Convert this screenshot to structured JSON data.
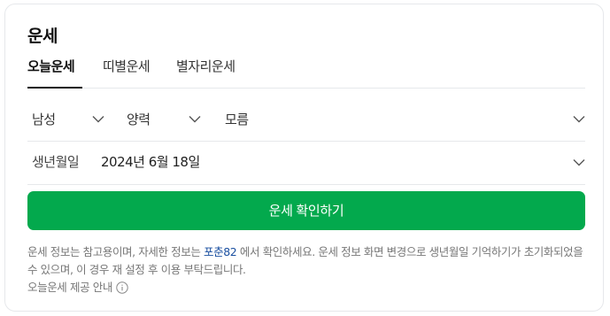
{
  "card": {
    "title": "운세"
  },
  "tabs": [
    {
      "label": "오늘운세",
      "active": true
    },
    {
      "label": "띠별운세",
      "active": false
    },
    {
      "label": "별자리운세",
      "active": false
    }
  ],
  "form": {
    "gender": {
      "value": "남성",
      "icon": "chevron-down-icon"
    },
    "calendar": {
      "value": "양력",
      "icon": "chevron-down-icon"
    },
    "birth_time": {
      "value": "모름",
      "icon": "chevron-down-icon"
    },
    "birth_date": {
      "label": "생년월일",
      "value": "2024년 6월 18일",
      "icon": "chevron-down-icon"
    }
  },
  "submit_label": "운세 확인하기",
  "notice": {
    "before_link": "운세 정보는 참고용이며, 자세한 정보는 ",
    "link": "포춘82",
    "after_link": " 에서 확인하세요. 운세 정보 화면 변경으로 생년월일 기억하기가 초기화되었을 수 있으며, 이 경우 재 설정 후 이용 부탁드립니다."
  },
  "provider_info": {
    "label": "오늘운세 제공 안내",
    "icon": "info-icon"
  },
  "colors": {
    "accent": "#03a94d",
    "link": "#1a4fa0",
    "border": "#e6e8eb"
  }
}
